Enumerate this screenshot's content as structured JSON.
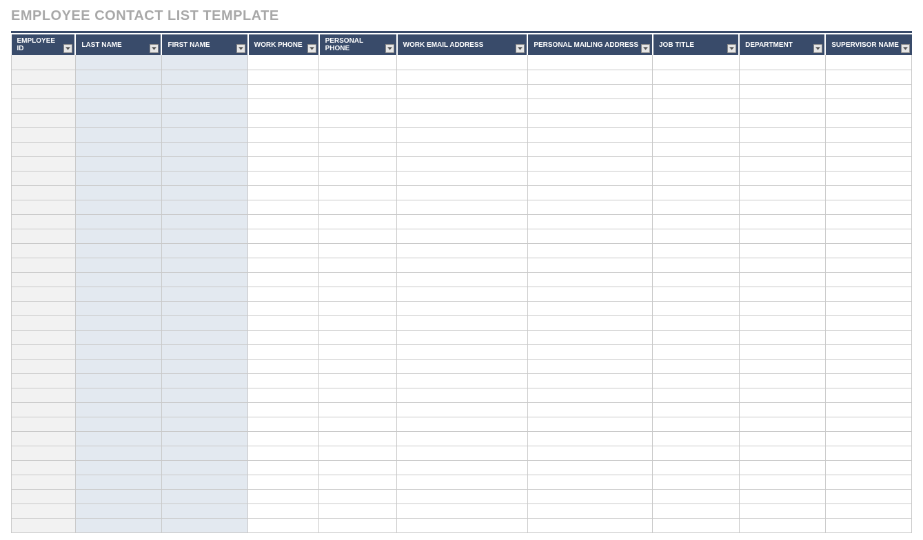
{
  "title": "EMPLOYEE CONTACT LIST TEMPLATE",
  "columns": [
    "EMPLOYEE ID",
    "LAST NAME",
    "FIRST NAME",
    "WORK PHONE",
    "PERSONAL PHONE",
    "WORK EMAIL ADDRESS",
    "PERSONAL MAILING ADDRESS",
    "JOB TITLE",
    "DEPARTMENT",
    "SUPERVISOR NAME"
  ],
  "row_count": 33,
  "shaded_columns": [
    0,
    1,
    2
  ]
}
